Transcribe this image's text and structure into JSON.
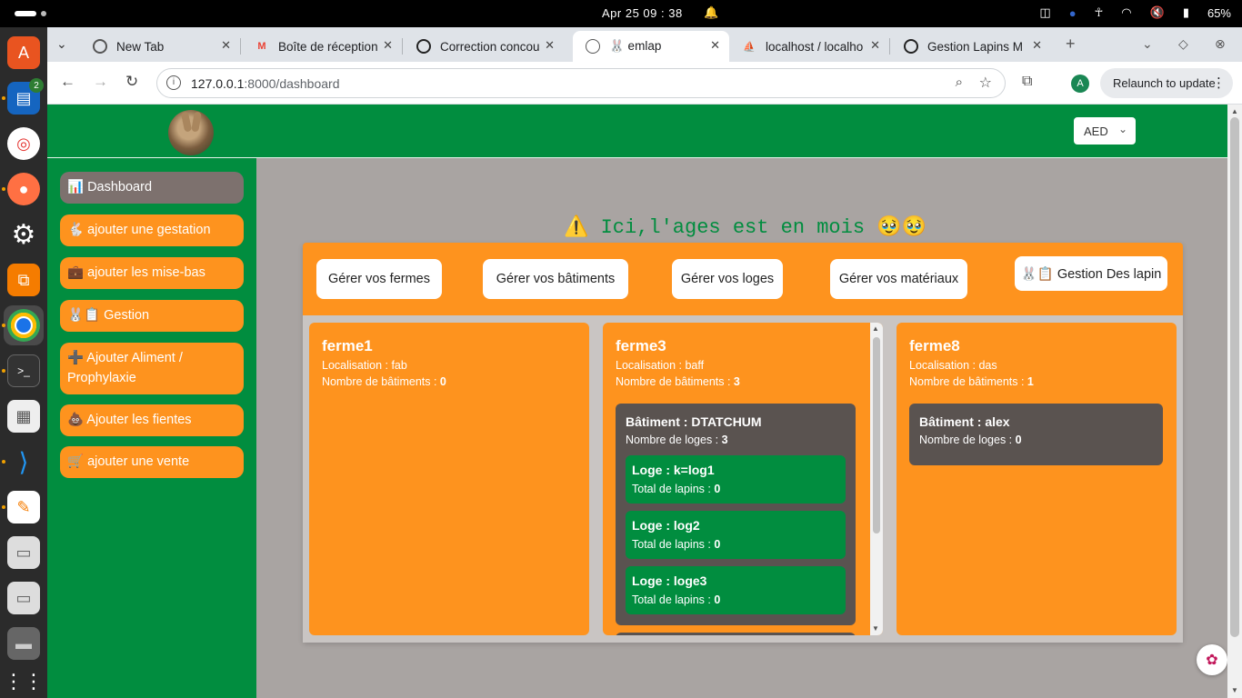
{
  "system_bar": {
    "clock": "Apr 25  09 : 38",
    "battery": "65%"
  },
  "dock": {
    "apps": [
      "software-center",
      "text-editor-2",
      "help",
      "firefox",
      "settings",
      "git-tool",
      "chrome",
      "terminal",
      "document-viewer",
      "vscode",
      "notes",
      "disk-1",
      "disk-2",
      "drive",
      "app-grid"
    ],
    "badge_count": "2"
  },
  "browser": {
    "tabs": [
      {
        "label": "New Tab",
        "icon": "chrome-icon"
      },
      {
        "label": "Boîte de réception",
        "icon": "gmail-icon"
      },
      {
        "label": "Correction concou",
        "icon": "openai-icon"
      },
      {
        "label": "🐰 emlap",
        "icon": "globe-icon"
      },
      {
        "label": "localhost / localho",
        "icon": "phpmyadmin-icon"
      },
      {
        "label": "Gestion Lapins M",
        "icon": "openai-icon"
      }
    ],
    "url_host": "127.0.0.1",
    "url_path": ":8000/dashboard",
    "profile_initial": "A",
    "relaunch_label": "Relaunch to update"
  },
  "header": {
    "currency": "AED"
  },
  "sidebar": {
    "items": [
      {
        "label": "📊 Dashboard"
      },
      {
        "label": "🐇 ajouter une gestation"
      },
      {
        "label": "💼 ajouter les mise-bas"
      },
      {
        "label": "🐰📋 Gestion"
      },
      {
        "label": "➕ Ajouter Aliment / Prophylaxie"
      },
      {
        "label": "💩 Ajouter les fientes"
      },
      {
        "label": "🛒 ajouter une vente"
      }
    ]
  },
  "main": {
    "notice": "⚠️ Ici,l'ages est en mois 🥹🥹",
    "nav_buttons": [
      {
        "label": "Gérer vos fermes"
      },
      {
        "label": "Gérer vos bâtiments"
      },
      {
        "label": "Gérer vos loges"
      },
      {
        "label": "Gérer vos matériaux"
      },
      {
        "label": "🐰📋 Gestion Des lapin"
      }
    ],
    "farms": [
      {
        "name": "ferme1",
        "loc_label": "Localisation : ",
        "loc": "fab",
        "count_label": "Nombre de bâtiments : ",
        "count": "0",
        "buildings": []
      },
      {
        "name": "ferme3",
        "loc_label": "Localisation : ",
        "loc": "baff",
        "count_label": "Nombre de bâtiments : ",
        "count": "3",
        "buildings": [
          {
            "name": "Bâtiment : DTATCHUM",
            "count_label": "Nombre de loges : ",
            "count": "3",
            "loges": [
              {
                "name": "Loge : k=log1",
                "total_label": "Total de lapins : ",
                "total": "0"
              },
              {
                "name": "Loge : log2",
                "total_label": "Total de lapins : ",
                "total": "0"
              },
              {
                "name": "Loge : loge3",
                "total_label": "Total de lapins : ",
                "total": "0"
              }
            ]
          }
        ]
      },
      {
        "name": "ferme8",
        "loc_label": "Localisation : ",
        "loc": "das",
        "count_label": "Nombre de bâtiments : ",
        "count": "1",
        "buildings": [
          {
            "name": "Bâtiment : alex",
            "count_label": "Nombre de loges : ",
            "count": "0",
            "loges": []
          }
        ]
      }
    ]
  },
  "colors": {
    "green": "#018d3f",
    "orange": "#fe931e",
    "grey_bg": "#a9a4a2",
    "building_bg": "#5a5350"
  }
}
